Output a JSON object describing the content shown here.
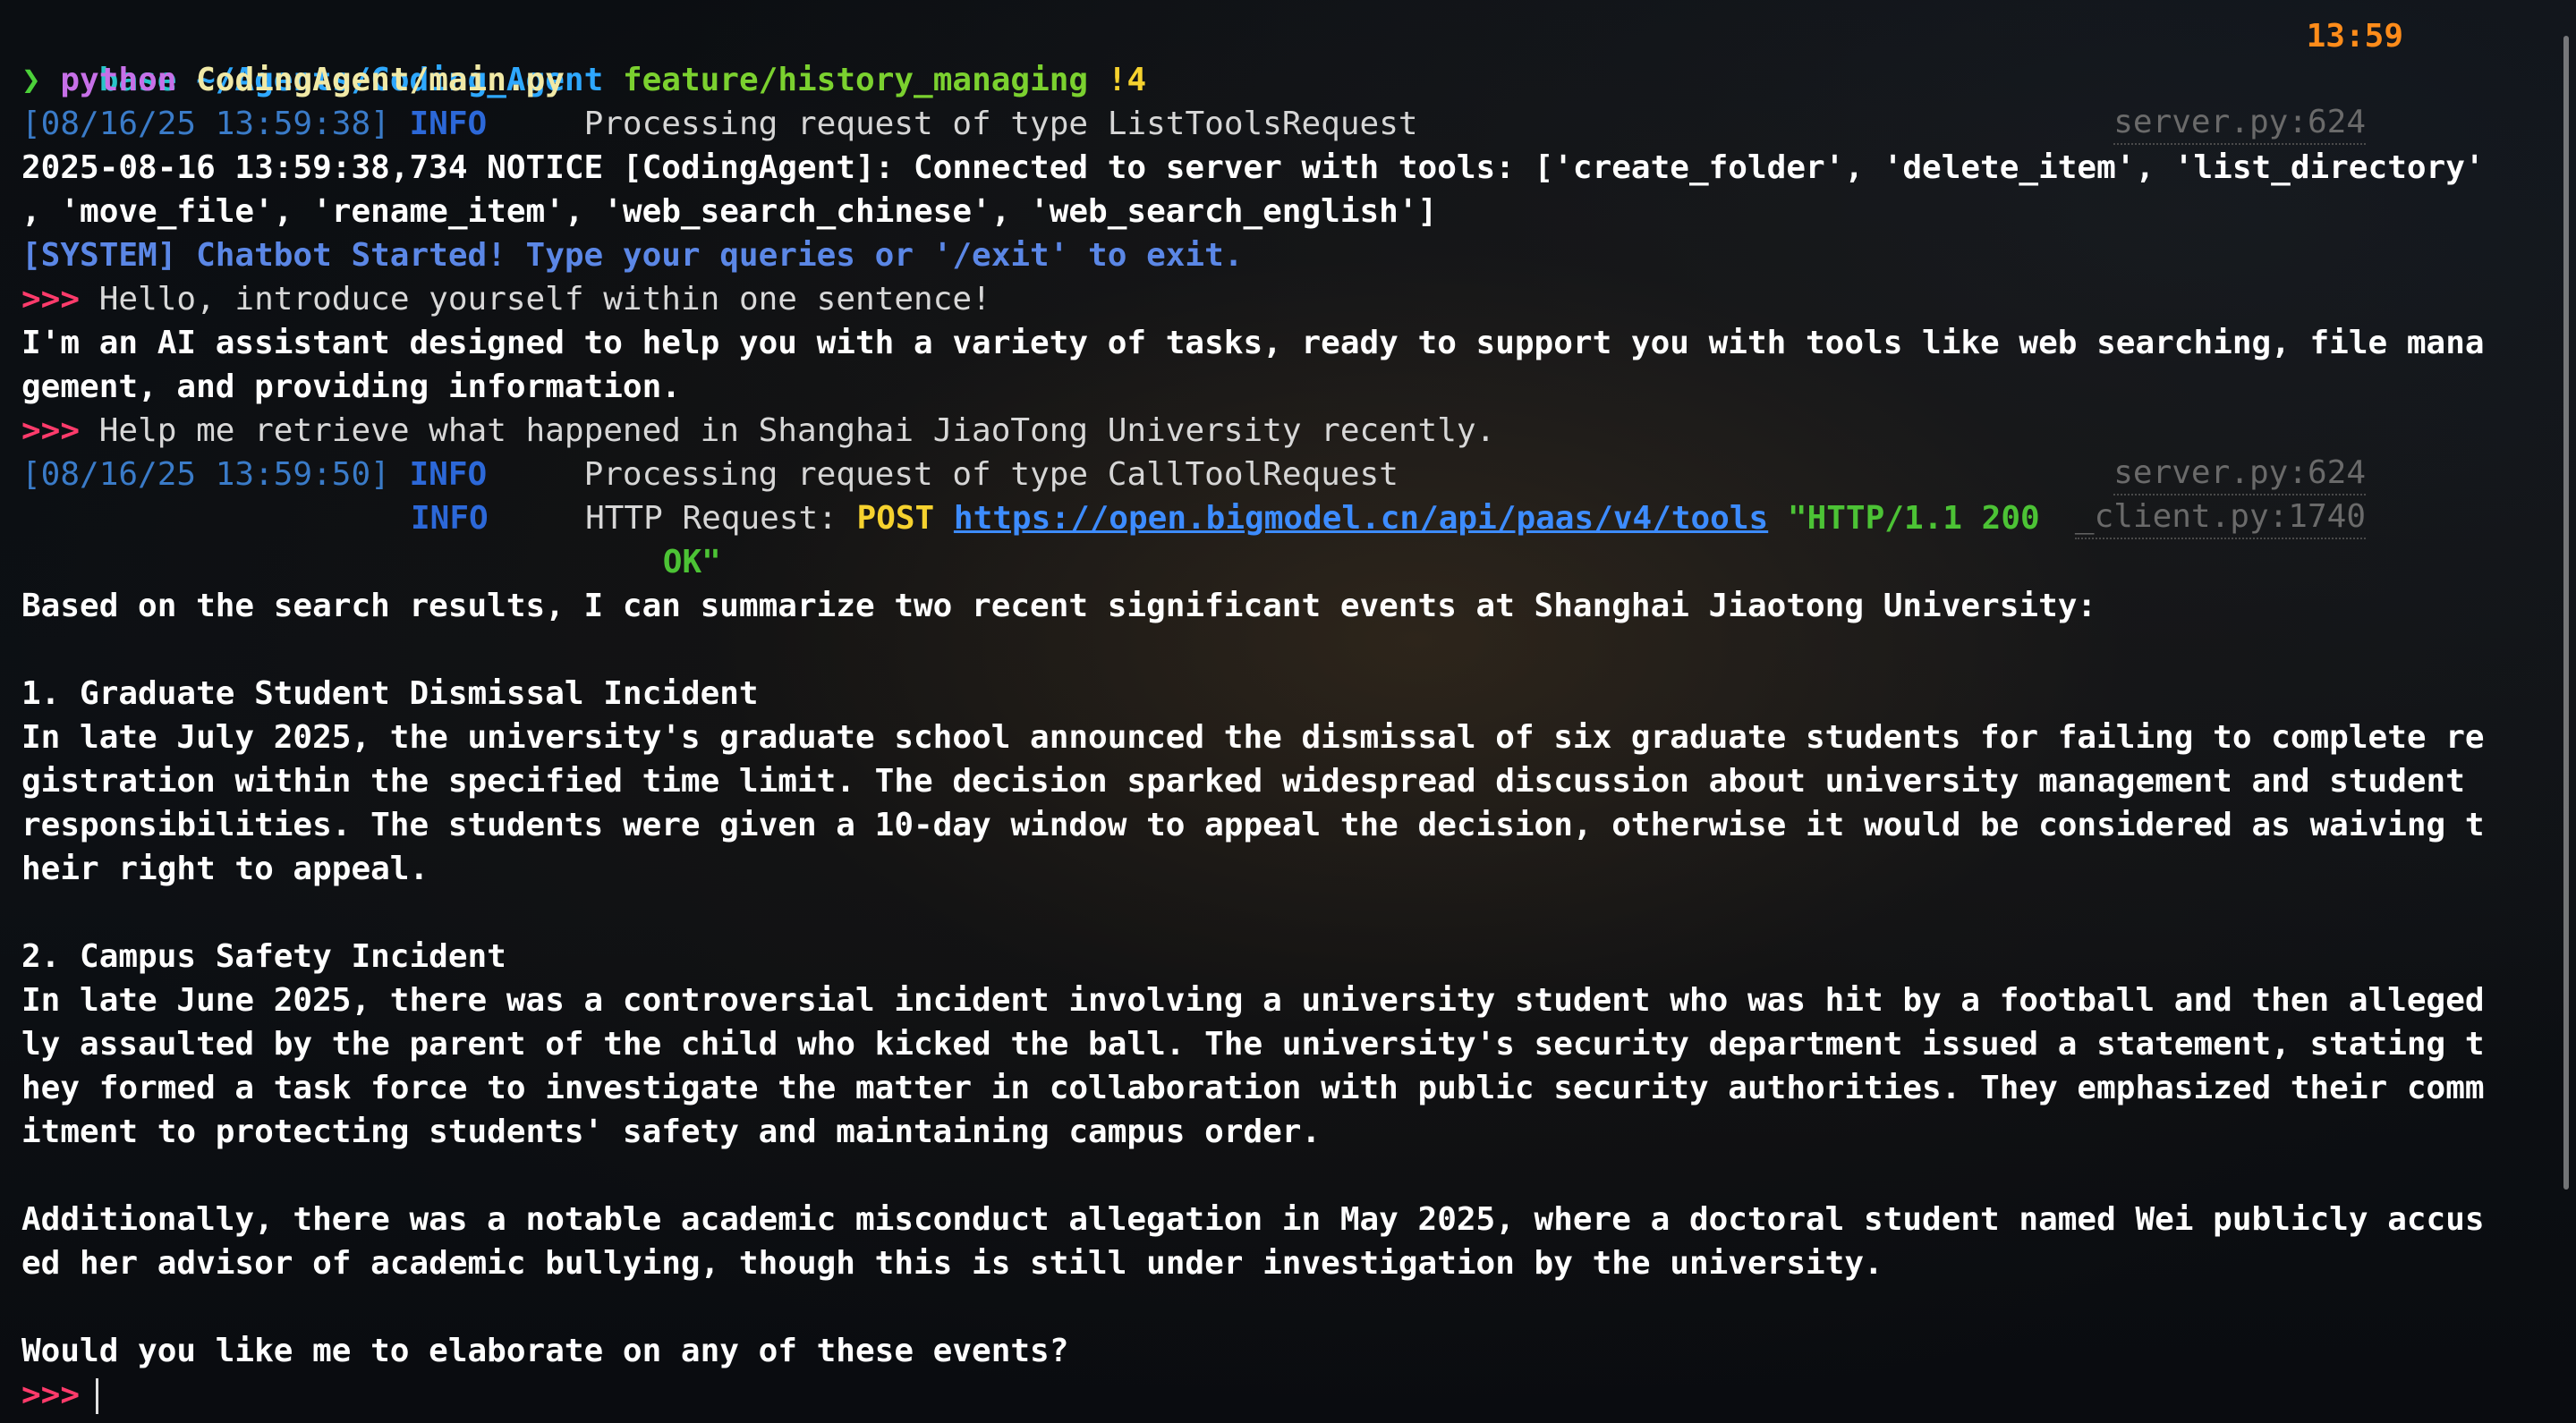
{
  "prompt": {
    "env": "base",
    "path": "~/Agents/Coding_Agent",
    "branch": "feature/history_managing",
    "dirty": "!4",
    "time": "13:59",
    "arrow": "❯",
    "command_bin": "python",
    "command_arg": "CodingAgent/main.py"
  },
  "logs": [
    {
      "timestamp": "[08/16/25 13:59:38]",
      "level": "INFO",
      "message": "Processing request of type ListToolsRequest",
      "source": "server.py:624"
    },
    {
      "timestamp": "[08/16/25 13:59:50]",
      "level": "INFO",
      "message": "Processing request of type CallToolRequest",
      "source": "server.py:624"
    }
  ],
  "notice": {
    "line1": "2025-08-16 13:59:38,734 NOTICE [CodingAgent]: Connected to server with tools: ['create_folder', 'delete_item', 'list_directory'",
    "line2": ", 'move_file', 'rename_item', 'web_search_chinese', 'web_search_english']"
  },
  "system_message": "[SYSTEM] Chatbot Started! Type your queries or '/exit' to exit.",
  "chevron": ">>>",
  "user_queries": [
    "Hello, introduce yourself within one sentence!",
    "Help me retrieve what happened in Shanghai JiaoTong University recently."
  ],
  "reply1": [
    "I'm an AI assistant designed to help you with a variety of tasks, ready to support you with tools like web searching, file mana",
    "gement, and providing information."
  ],
  "http_log": {
    "level": "INFO",
    "prefix": "HTTP Request: ",
    "method": "POST",
    "url": "https://open.bigmodel.cn/api/paas/v4/tools",
    "status_a": "\"HTTP/1.1 200",
    "status_b": "OK\"",
    "source": "_client.py:1740"
  },
  "reply2": [
    "Based on the search results, I can summarize two recent significant events at Shanghai Jiaotong University:",
    "",
    "1. Graduate Student Dismissal Incident",
    "In late July 2025, the university's graduate school announced the dismissal of six graduate students for failing to complete re",
    "gistration within the specified time limit. The decision sparked widespread discussion about university management and student",
    "responsibilities. The students were given a 10-day window to appeal the decision, otherwise it would be considered as waiving t",
    "heir right to appeal.",
    "",
    "2. Campus Safety Incident",
    "In late June 2025, there was a controversial incident involving a university student who was hit by a football and then alleged",
    "ly assaulted by the parent of the child who kicked the ball. The university's security department issued a statement, stating t",
    "hey formed a task force to investigate the matter in collaboration with public security authorities. They emphasized their comm",
    "itment to protecting students' safety and maintaining campus order.",
    "",
    "Additionally, there was a notable academic misconduct allegation in May 2025, where a doctoral student named Wei publicly accus",
    "ed her advisor of academic bullying, though this is still under investigation by the university.",
    "",
    "Would you like me to elaborate on any of these events?"
  ]
}
